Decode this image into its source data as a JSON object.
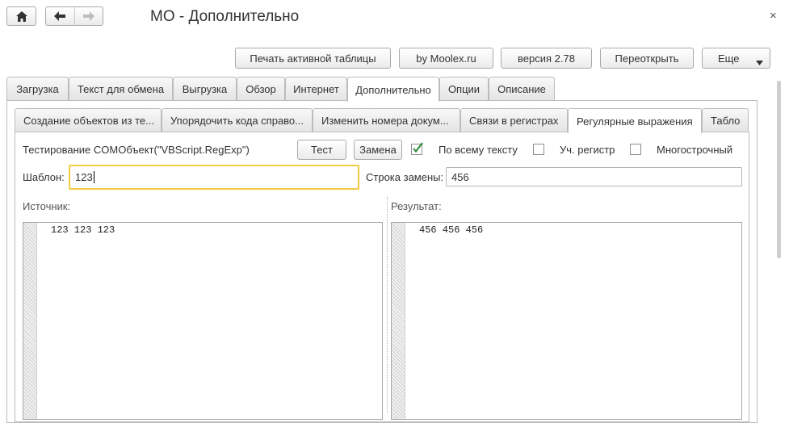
{
  "window": {
    "title": "МО - Дополнительно",
    "close_glyph": "×"
  },
  "nav": {
    "home_icon": "home-icon",
    "back_icon": "arrow-left-icon",
    "forward_icon": "arrow-right-icon"
  },
  "toolbar": {
    "print_label": "Печать активной таблицы",
    "moolex_label": "by Moolex.ru",
    "version_label": "версия 2.78",
    "reopen_label": "Переоткрыть",
    "more_label": "Еще"
  },
  "main_tabs": [
    {
      "label": "Загрузка",
      "active": false
    },
    {
      "label": "Текст для обмена",
      "active": false
    },
    {
      "label": "Выгрузка",
      "active": false
    },
    {
      "label": "Обзор",
      "active": false
    },
    {
      "label": "Интернет",
      "active": false
    },
    {
      "label": "Дополнительно",
      "active": true
    },
    {
      "label": "Опции",
      "active": false
    },
    {
      "label": "Описание",
      "active": false
    }
  ],
  "sub_tabs": [
    {
      "label": "Создание объектов из те...",
      "active": false
    },
    {
      "label": "Упорядочить кода справо...",
      "active": false
    },
    {
      "label": "Изменить номера докум...",
      "active": false
    },
    {
      "label": "Связи в регистрах",
      "active": false
    },
    {
      "label": "Регулярные выражения",
      "active": true
    },
    {
      "label": "Табло",
      "active": false
    }
  ],
  "regexp": {
    "heading": "Тестирование COMОбъект(\"VBScript.RegExp\")",
    "test_button": "Тест",
    "replace_button": "Замена",
    "global_label": "По всему тексту",
    "global_checked": true,
    "ignorecase_label": "Уч. регистр",
    "ignorecase_checked": false,
    "multiline_label": "Многострочный",
    "multiline_checked": false,
    "pattern_label": "Шаблон:",
    "pattern_value": "123",
    "replacement_label": "Строка замены:",
    "replacement_value": "456",
    "source_label": "Источник:",
    "source_text": "123 123 123",
    "result_label": "Результат:",
    "result_text": "456 456 456",
    "accent_color": "#f2cb43",
    "check_color": "#2e8b3a"
  }
}
